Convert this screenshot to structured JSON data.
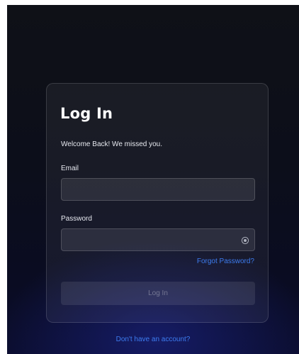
{
  "login": {
    "title": "Log In",
    "subtitle": "Welcome Back! We missed you.",
    "email_label": "Email",
    "email_value": "",
    "password_label": "Password",
    "password_value": "",
    "forgot_password": "Forgot Password?",
    "submit_label": "Log In",
    "show_password_icon": "eye-icon"
  },
  "footer": {
    "signup_link": "Don't have an account?"
  },
  "colors": {
    "link": "#3d7cf0",
    "background": "#0c0e1a"
  }
}
